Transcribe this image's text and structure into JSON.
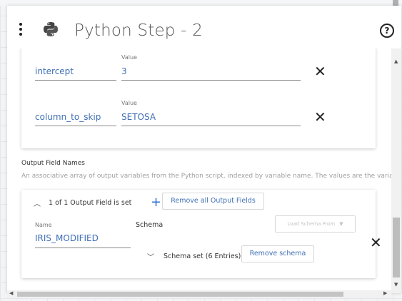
{
  "header": {
    "title": "Python Step - 2",
    "menu_icon": "kebab-menu-icon",
    "logo_icon": "python-logo-icon",
    "help_icon": "help-circle-icon"
  },
  "params": [
    {
      "name": "intercept",
      "value_label": "Value",
      "value": "3"
    },
    {
      "name": "column_to_skip",
      "value_label": "Value",
      "value": "SETOSA"
    }
  ],
  "output_section": {
    "title": "Output Field Names",
    "description": "An associative array of output variables from the Python script, indexed by variable name. The values are the variable"
  },
  "output_card": {
    "status": "1 of 1 Output Field is set",
    "add_icon": "plus-icon",
    "remove_all_label": "Remove all Output Fields",
    "name_label": "Name",
    "name_value": "IRIS_MODIFIED",
    "schema_label": "Schema",
    "load_schema_label": "Load Schema From",
    "schema_set_text": "Schema set (6 Entries)",
    "remove_schema_label": "Remove schema"
  },
  "colors": {
    "accent": "#3f6fb5",
    "plus": "#2a6fd0",
    "text": "#333333"
  }
}
